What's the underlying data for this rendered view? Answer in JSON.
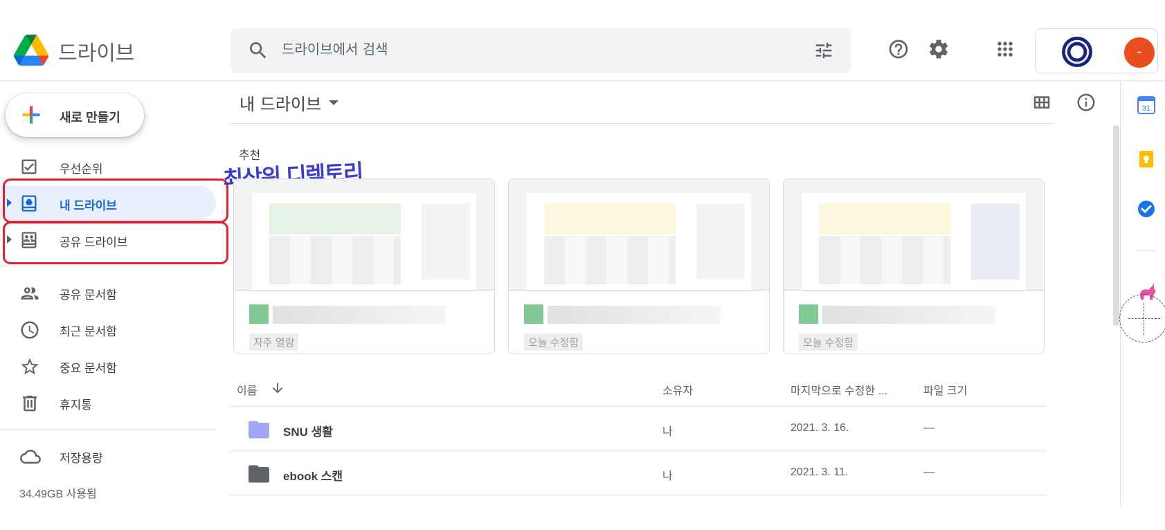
{
  "header": {
    "brand": "드라이브",
    "search_placeholder": "드라이브에서 검색",
    "avatar_letter": "-"
  },
  "sidebar": {
    "new_label": "새로 만들기",
    "items": [
      {
        "label": "우선순위",
        "icon": "priority-check-icon"
      },
      {
        "label": "내 드라이브",
        "icon": "my-drive-icon",
        "active": true
      },
      {
        "label": "공유 드라이브",
        "icon": "shared-drive-icon"
      },
      {
        "label": "공유 문서함",
        "icon": "people-icon"
      },
      {
        "label": "최근 문서함",
        "icon": "clock-icon"
      },
      {
        "label": "중요 문서함",
        "icon": "star-icon"
      },
      {
        "label": "휴지통",
        "icon": "trash-icon"
      },
      {
        "label": "저장용량",
        "icon": "cloud-icon"
      }
    ],
    "storage_used": "34.49GB 사용됨"
  },
  "annotation": {
    "text": "최상위 디렉토리",
    "color": "#3b3fd1",
    "box_color": "#e5202b"
  },
  "main": {
    "title": "내 드라이브",
    "recommended_label": "추천",
    "cards": [
      {
        "reason": "자주 열람"
      },
      {
        "reason": "오늘 수정함"
      },
      {
        "reason": "오늘 수정함"
      }
    ],
    "columns": {
      "name": "이름",
      "owner": "소유자",
      "modified": "마지막으로 수정한 ...",
      "size": "파일 크기"
    },
    "files": [
      {
        "name": "SNU 생활",
        "owner": "나",
        "modified": "2021. 3. 16.",
        "size": "—",
        "folder_color": "#a3a6f7"
      },
      {
        "name": "ebook 스캔",
        "owner": "나",
        "modified": "2021. 3. 11.",
        "size": "—",
        "folder_color": "#5f6368"
      }
    ]
  },
  "right_panel": {
    "calendar_day": "31"
  },
  "colors": {
    "accent": "#1967d2",
    "active_bg": "#e8f0fe"
  }
}
